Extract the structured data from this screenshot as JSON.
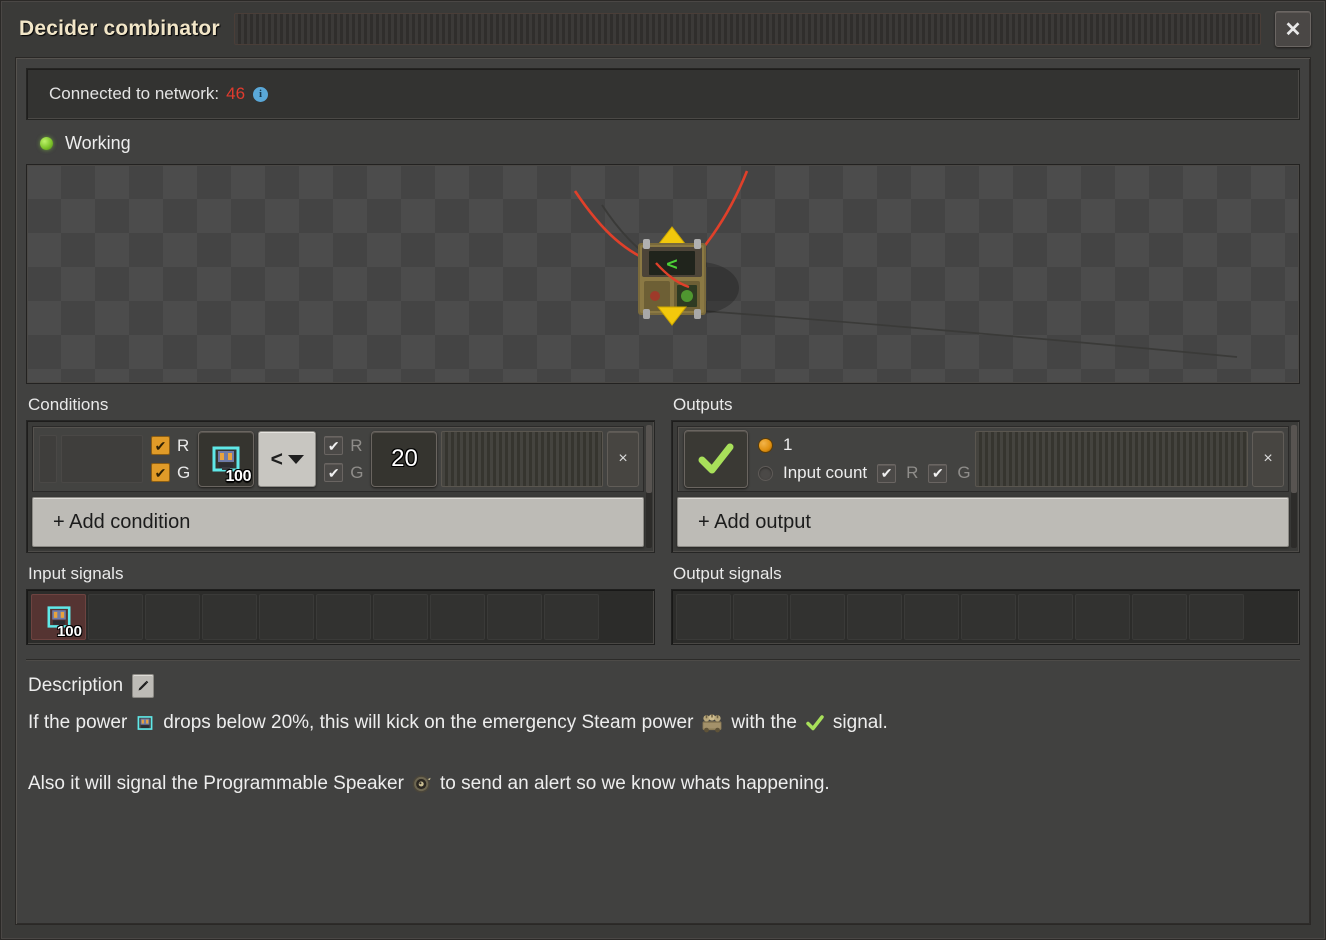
{
  "window": {
    "title": "Decider combinator",
    "close_label": "✕",
    "close_icon": "close-icon",
    "drag_handle_icon": "drag-handle-stripes"
  },
  "network": {
    "label": "Connected to network:",
    "value": "46",
    "info_icon": "info-icon",
    "info_glyph": "i"
  },
  "status": {
    "text": "Working",
    "indicator_icon": "status-dot-green",
    "color": "#7fc52c"
  },
  "preview": {
    "entity_icon": "decider-combinator-entity",
    "screen_symbol": "<",
    "wire_colors": {
      "red": "#e0402a",
      "black": "#3c3c3c"
    },
    "arrow_color": "#f2c80c"
  },
  "conditions": {
    "heading": "Conditions",
    "rows": [
      {
        "left_checkbox_r": {
          "label": "R",
          "checked": true,
          "style": "orange"
        },
        "left_checkbox_g": {
          "label": "G",
          "checked": true,
          "style": "orange"
        },
        "signal": {
          "icon": "accumulator-signal-icon",
          "count": "100"
        },
        "comparator": {
          "value": "<",
          "caret_icon": "chevron-down-icon"
        },
        "right_checkbox_r": {
          "label": "R",
          "checked": true,
          "style": "dark"
        },
        "right_checkbox_g": {
          "label": "G",
          "checked": true,
          "style": "dark"
        },
        "constant": "20",
        "handle_icon": "drag-handle-stripes",
        "delete_label": "×"
      }
    ],
    "add_label": "+ Add condition"
  },
  "outputs": {
    "heading": "Outputs",
    "rows": [
      {
        "signal": {
          "icon": "checkmark-signal-icon"
        },
        "options": [
          {
            "label": "1",
            "selected": true
          },
          {
            "label": "Input count",
            "selected": false
          }
        ],
        "checkbox_r": {
          "label": "R",
          "checked": true,
          "style": "dark"
        },
        "checkbox_g": {
          "label": "G",
          "checked": true,
          "style": "dark"
        },
        "handle_icon": "drag-handle-stripes",
        "delete_label": "×"
      }
    ],
    "add_label": "+ Add output"
  },
  "input_signals": {
    "heading": "Input signals",
    "slot_count": 10,
    "slots": [
      {
        "icon": "accumulator-signal-icon",
        "count": "100",
        "filled": true
      },
      {
        "filled": false
      },
      {
        "filled": false
      },
      {
        "filled": false
      },
      {
        "filled": false
      },
      {
        "filled": false
      },
      {
        "filled": false
      },
      {
        "filled": false
      },
      {
        "filled": false
      },
      {
        "filled": false
      }
    ]
  },
  "output_signals": {
    "heading": "Output signals",
    "slot_count": 10,
    "slots": [
      {
        "filled": false
      },
      {
        "filled": false
      },
      {
        "filled": false
      },
      {
        "filled": false
      },
      {
        "filled": false
      },
      {
        "filled": false
      },
      {
        "filled": false
      },
      {
        "filled": false
      },
      {
        "filled": false
      },
      {
        "filled": false
      }
    ]
  },
  "description": {
    "heading": "Description",
    "edit_icon": "pencil-edit-icon",
    "line1_part1": "If the power",
    "line1_icon1": "accumulator-icon",
    "line1_part2": "drops below 20%, this will kick on the emergency Steam power",
    "line1_icon2": "steam-engine-icon",
    "line1_part3": "with the",
    "line1_icon3": "checkmark-signal-icon",
    "line1_part4": "signal.",
    "line2_part1": "Also it will signal the Programmable Speaker",
    "line2_icon1": "programmable-speaker-icon",
    "line2_part2": "to send an alert so we know whats happening."
  }
}
